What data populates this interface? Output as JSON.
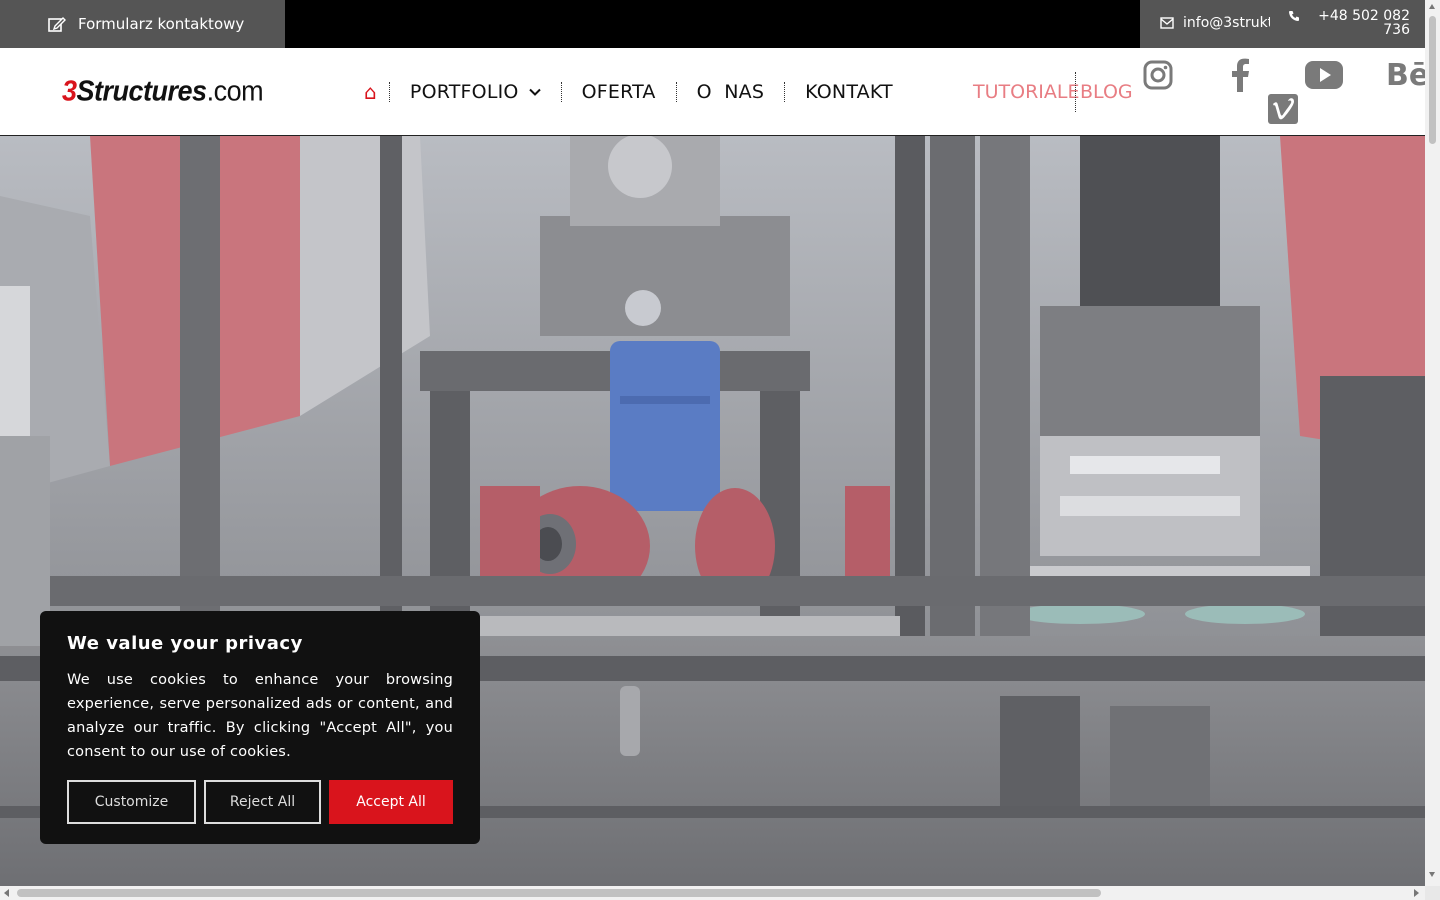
{
  "topbar": {
    "form_label": "Formularz  kontaktowy",
    "email": "info@3strukt",
    "phone": "+48  502  082  736"
  },
  "logo": {
    "three": "3",
    "structures": "Structures",
    "com": ".com"
  },
  "nav": {
    "home_icon": "⌂",
    "items": [
      "PORTFOLIO",
      "OFERTA",
      "O  NAS",
      "KONTAKT"
    ],
    "tutoriale": "TUTORIALE",
    "blog": "BLOG"
  },
  "social": {
    "icons": [
      "instagram-icon",
      "facebook-icon",
      "youtube-icon",
      "behance-icon",
      "vimeo-icon"
    ],
    "behance_text": "Bē"
  },
  "cookie": {
    "title": "We value your privacy",
    "body": "We use cookies to enhance your browsing experience, serve personalized ads or content, and analyze our traffic. By clicking \"Accept All\", you consent to our use of cookies.",
    "customize": "Customize",
    "reject": "Reject All",
    "accept": "Accept All"
  },
  "colors": {
    "brand_red": "#d9141c",
    "link_pink": "#e87d83",
    "topbar_gray": "#555555",
    "social_gray": "#7a7a7a"
  }
}
